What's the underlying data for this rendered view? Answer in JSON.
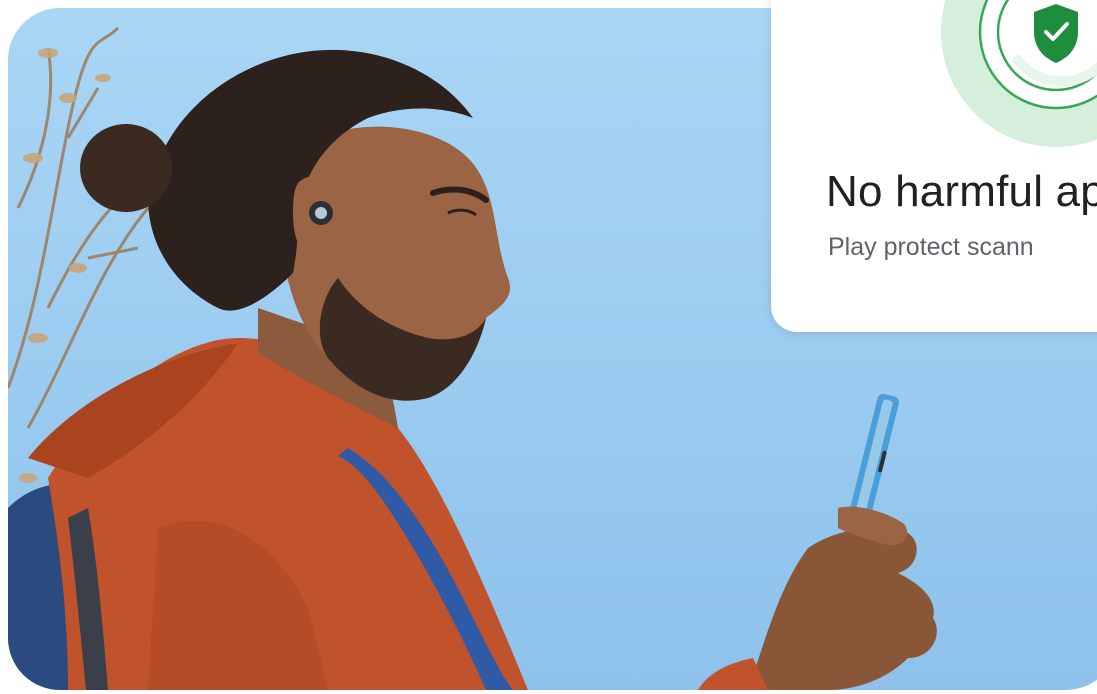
{
  "image": {
    "description_alt": "",
    "subject": "man-with-earbud-holding-phone"
  },
  "play_protect_card": {
    "title": "No harmful ap",
    "subtitle": "Play protect scann",
    "icon": "shield-check-icon",
    "colors": {
      "accent_green": "#1e8e3e",
      "ring_green": "#34a853",
      "halo_green": "#ceead6",
      "title_text": "#202124",
      "subtitle_text": "#5f6368"
    }
  },
  "colors": {
    "sky": "#9dcdf1",
    "jacket": "#c0532c",
    "backpack_strap": "#2f5aa6",
    "phone": "#4a9fd8"
  }
}
